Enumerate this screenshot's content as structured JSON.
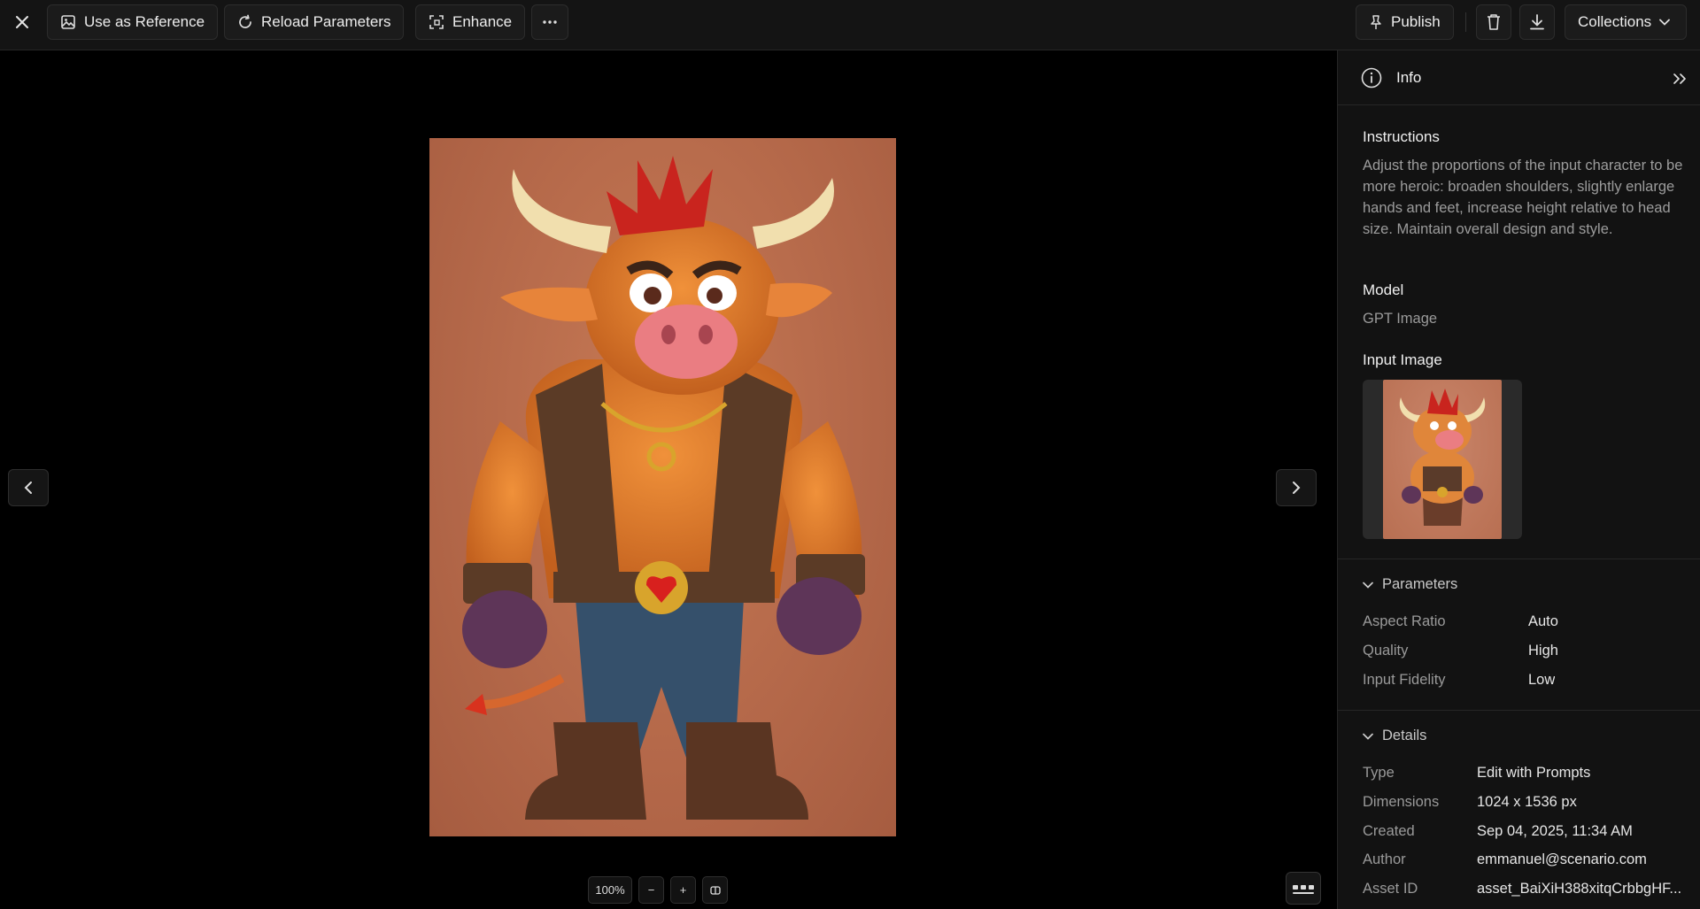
{
  "toolbar": {
    "use_as_reference": "Use as Reference",
    "reload_parameters": "Reload Parameters",
    "enhance": "Enhance",
    "more": "···",
    "publish": "Publish",
    "collections": "Collections"
  },
  "viewer": {
    "zoom": "100%",
    "zoom_out": "−",
    "zoom_in": "+"
  },
  "panel": {
    "title": "Info",
    "instructions_label": "Instructions",
    "instructions_text": "Adjust the proportions of the input character to be more heroic: broaden shoulders, slightly enlarge hands and feet, increase height relative to head size. Maintain overall design and style.",
    "model_label": "Model",
    "model_value": "GPT Image",
    "input_image_label": "Input Image",
    "parameters": {
      "label": "Parameters",
      "rows": [
        {
          "key": "Aspect Ratio",
          "value": "Auto"
        },
        {
          "key": "Quality",
          "value": "High"
        },
        {
          "key": "Input Fidelity",
          "value": "Low"
        }
      ]
    },
    "details": {
      "label": "Details",
      "rows": [
        {
          "key": "Type",
          "value": "Edit with Prompts"
        },
        {
          "key": "Dimensions",
          "value": "1024 x 1536 px"
        },
        {
          "key": "Created",
          "value": "Sep 04, 2025, 11:34 AM"
        },
        {
          "key": "Author",
          "value": "emmanuel@scenario.com"
        },
        {
          "key": "Asset ID",
          "value": "asset_BaiXiH388xitqCrbbgHF..."
        }
      ]
    }
  },
  "colors": {
    "background": "#000000",
    "toolbar": "#141414",
    "panel": "#121212",
    "image_backdrop": "#b5694a"
  }
}
